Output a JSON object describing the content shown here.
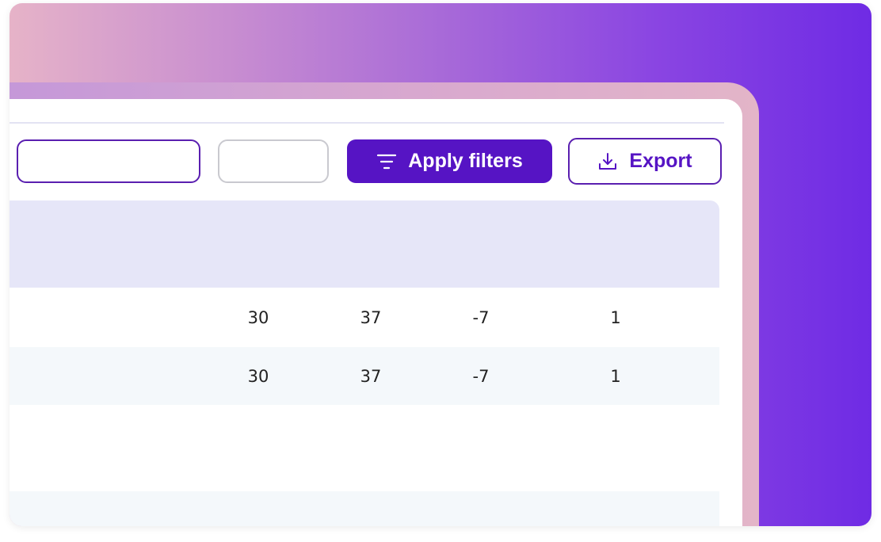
{
  "toolbar": {
    "apply_filters_label": "Apply filters",
    "export_label": "Export",
    "search_value": "",
    "small_field_value": ""
  },
  "icons": {
    "filter": "filter-lines-icon",
    "export": "download-tray-icon"
  },
  "table": {
    "rows": [
      {
        "cells": [
          "30",
          "37",
          "-7",
          "1"
        ]
      },
      {
        "cells": [
          "30",
          "37",
          "-7",
          "1"
        ]
      }
    ]
  },
  "colors": {
    "primary": "#5614c4",
    "header_bg": "#e6e6f8",
    "alt_row_bg": "#f4f8fb",
    "gradient_left": "#e6b3c8",
    "gradient_right": "#6f2be4"
  }
}
